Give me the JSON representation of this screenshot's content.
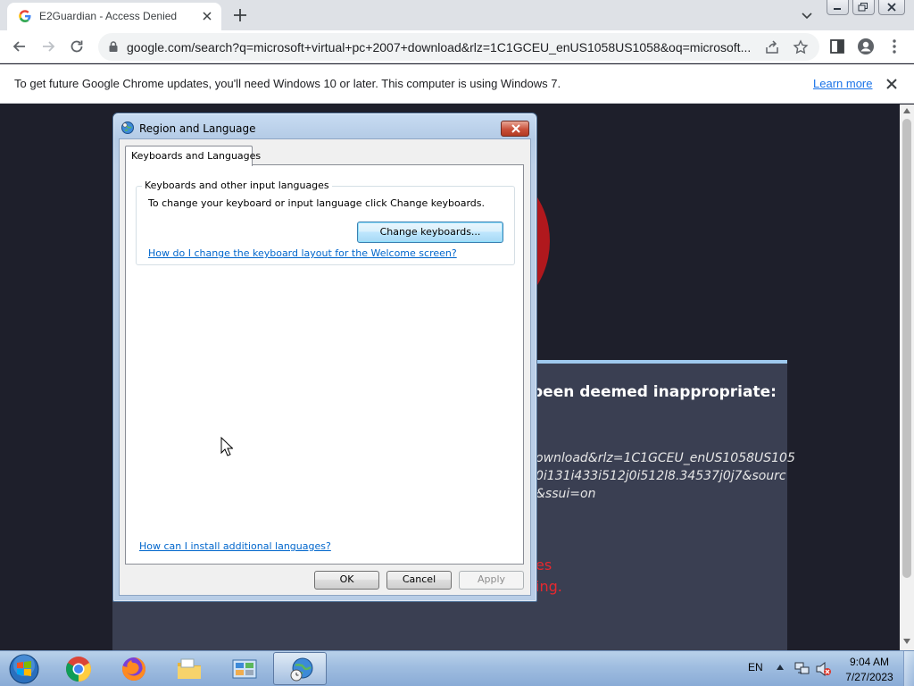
{
  "browser": {
    "tab_title": "E2Guardian - Access Denied",
    "url": "google.com/search?q=microsoft+virtual+pc+2007+download&rlz=1C1GCEU_enUS1058US1058&oq=microsoft...",
    "infobar_message": "To get future Google Chrome updates, you'll need Windows 10 or later. This computer is using Windows 7.",
    "infobar_link": "Learn more"
  },
  "background_page": {
    "heading": "been deemed inappropriate:",
    "url_line1": "ownload&rlz=1C1GCEU_enUS1058US105",
    "url_line2": "0i131i433i512j0i512l8.34537j0j7&sourc",
    "url_line3": "&ssui=on",
    "red_line1": "es",
    "red_line2": "ing."
  },
  "dialog": {
    "title": "Region and Language",
    "tab": "Keyboards and Languages",
    "group_label": "Keyboards and other input languages",
    "group_description": "To change your keyboard or input language click Change keyboards.",
    "change_keyboards_button": "Change keyboards...",
    "keyboard_layout_link": "How do I change the keyboard layout for the Welcome screen?",
    "install_languages_link": "How can I install additional languages?",
    "ok_button": "OK",
    "cancel_button": "Cancel",
    "apply_button": "Apply"
  },
  "taskbar": {
    "apps": [
      "Google Chrome",
      "Firefox",
      "Windows Explorer",
      "Control Panel",
      "Region and Language"
    ],
    "language": "EN",
    "time": "9:04 AM",
    "date": "7/27/2023"
  },
  "colors": {
    "dialog_link": "#0066cc",
    "chrome_link": "#1a73e8",
    "blocked_red": "#e8282e",
    "page_background": "#1e1f2b"
  }
}
